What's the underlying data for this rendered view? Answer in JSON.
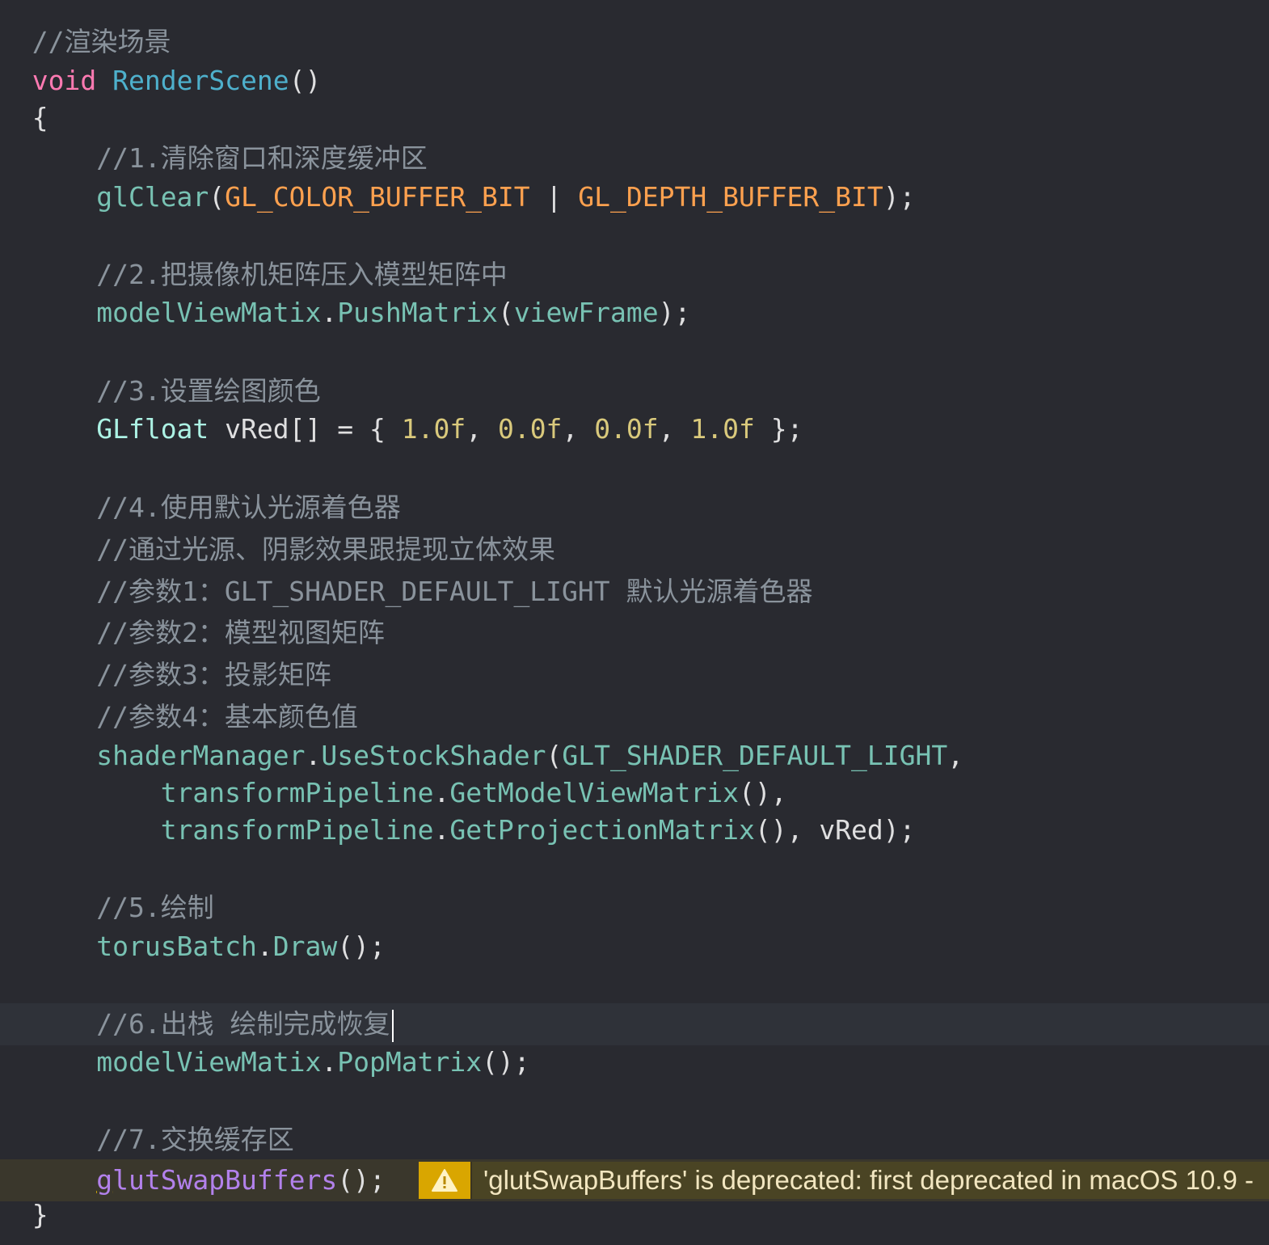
{
  "editor": {
    "lines": {
      "l1": {
        "comment": "//渲染场景"
      },
      "l2": {
        "kw": "void",
        "fn": "RenderScene",
        "rest": "()"
      },
      "l3": {
        "text": "{"
      },
      "l4": {
        "comment": "//1.清除窗口和深度缓冲区"
      },
      "l5": {
        "fn": "glClear",
        "open": "(",
        "m1": "GL_COLOR_BUFFER_BIT",
        "sep": " | ",
        "m2": "GL_DEPTH_BUFFER_BIT",
        "close": ");"
      },
      "l7": {
        "comment": "//2.把摄像机矩阵压入模型矩阵中"
      },
      "l8": {
        "obj": "modelViewMatix",
        "dot": ".",
        "method": "PushMatrix",
        "open": "(",
        "arg": "viewFrame",
        "close": ");"
      },
      "l10": {
        "comment": "//3.设置绘图颜色"
      },
      "l11": {
        "type": "GLfloat",
        "decl": " vRed[] = { ",
        "n1": "1.0f",
        "c1": ", ",
        "n2": "0.0f",
        "c2": ", ",
        "n3": "0.0f",
        "c3": ", ",
        "n4": "1.0f",
        "end": " };"
      },
      "l13": {
        "comment": "//4.使用默认光源着色器"
      },
      "l14": {
        "comment": "//通过光源、阴影效果跟提现立体效果"
      },
      "l15": {
        "comment": "//参数1：GLT_SHADER_DEFAULT_LIGHT 默认光源着色器"
      },
      "l16": {
        "comment": "//参数2：模型视图矩阵"
      },
      "l17": {
        "comment": "//参数3：投影矩阵"
      },
      "l18": {
        "comment": "//参数4：基本颜色值"
      },
      "l19": {
        "obj": "shaderManager",
        "dot": ".",
        "method": "UseStockShader",
        "open": "(",
        "arg": "GLT_SHADER_DEFAULT_LIGHT",
        "close": ","
      },
      "l20": {
        "obj": "transformPipeline",
        "dot": ".",
        "method": "GetModelViewMatrix",
        "close": "(),"
      },
      "l21": {
        "obj": "transformPipeline",
        "dot": ".",
        "method": "GetProjectionMatrix",
        "mid": "(), ",
        "arg": "vRed",
        "close": ");"
      },
      "l23": {
        "comment": "//5.绘制"
      },
      "l24": {
        "obj": "torusBatch",
        "dot": ".",
        "method": "Draw",
        "close": "();"
      },
      "l26": {
        "comment": "//6.出栈 绘制完成恢复"
      },
      "l27": {
        "obj": "modelViewMatix",
        "dot": ".",
        "method": "PopMatrix",
        "close": "();"
      },
      "l29": {
        "comment": "//7.交换缓存区"
      },
      "l30": {
        "first": "g",
        "fn": "lutSwapBuffers",
        "close": "();"
      },
      "l31": {
        "text": "}"
      }
    },
    "warning": {
      "icon": "warning-triangle-icon",
      "message": "'glutSwapBuffers' is deprecated: first deprecated in macOS 10.9 -"
    },
    "colors": {
      "background": "#292a30",
      "current_line": "#2f3239",
      "comment": "#8a939c",
      "keyword": "#ff7ab2",
      "declaration": "#4eb0cc",
      "project_function": "#78c2b3",
      "macro": "#ffa14f",
      "number": "#d9c97c",
      "warning_bg": "#d9a600"
    }
  }
}
